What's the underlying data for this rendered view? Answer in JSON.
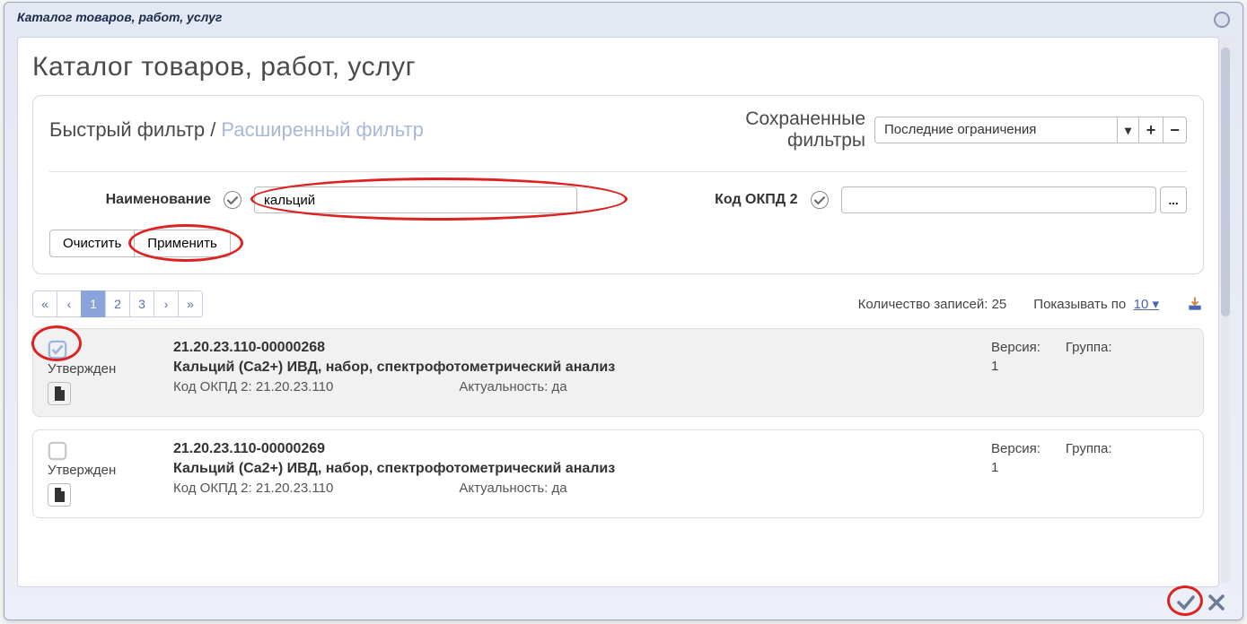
{
  "window": {
    "title": "Каталог товаров, работ, услуг"
  },
  "page": {
    "title": "Каталог товаров, работ, услуг"
  },
  "filter": {
    "tab_quick": "Быстрый фильтр",
    "tab_sep": " / ",
    "tab_ext": "Расширенный фильтр",
    "saved_label_line1": "Сохраненные",
    "saved_label_line2": "фильтры",
    "saved_selected": "Последние ограничения",
    "name_label": "Наименование",
    "name_value": "кальций",
    "okpd_label": "Код ОКПД 2",
    "okpd_value": "",
    "browse": "...",
    "clear": "Очистить",
    "apply": "Применить"
  },
  "toolbar": {
    "records_label": "Количество записей:",
    "records_count": "25",
    "page_size_label": "Показывать по",
    "page_size": "10"
  },
  "pager": [
    "«",
    "‹",
    "1",
    "2",
    "3",
    "›",
    "»"
  ],
  "items": [
    {
      "checked": true,
      "status": "Утвержден",
      "code": "21.20.23.110-00000268",
      "name": "Кальций (Ca2+) ИВД, набор, спектрофотометрический анализ",
      "okpd_label": "Код ОКПД 2:",
      "okpd": "21.20.23.110",
      "actual_label": "Актуальность:",
      "actual": "да",
      "version_label": "Версия:",
      "version": "1",
      "group_label": "Группа:",
      "group": ""
    },
    {
      "checked": false,
      "status": "Утвержден",
      "code": "21.20.23.110-00000269",
      "name": "Кальций (Ca2+) ИВД, набор, спектрофотометрический анализ",
      "okpd_label": "Код ОКПД 2:",
      "okpd": "21.20.23.110",
      "actual_label": "Актуальность:",
      "actual": "да",
      "version_label": "Версия:",
      "version": "1",
      "group_label": "Группа:",
      "group": ""
    }
  ]
}
